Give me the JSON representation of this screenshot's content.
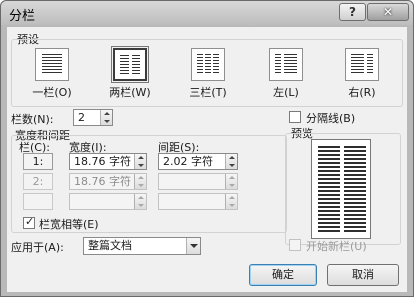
{
  "window": {
    "title": "分栏",
    "help_label": "?",
    "close_label": "✕"
  },
  "presets": {
    "group_label": "预设",
    "items": [
      {
        "label": "一栏(O)",
        "columns": 1,
        "selected": false
      },
      {
        "label": "两栏(W)",
        "columns": 2,
        "selected": true
      },
      {
        "label": "三栏(T)",
        "columns": 3,
        "selected": false
      },
      {
        "label": "左(L)",
        "columns": 2,
        "selected": false
      },
      {
        "label": "右(R)",
        "columns": 2,
        "selected": false
      }
    ]
  },
  "column_count": {
    "label": "栏数(N):",
    "value": "2"
  },
  "divider": {
    "label": "分隔线(B)",
    "checked": false
  },
  "width_spacing": {
    "group_label": "宽度和间距",
    "col_header": "栏(C):",
    "width_header": "宽度(I):",
    "spacing_header": "间距(S):",
    "rows": [
      {
        "num": "1:",
        "width": "18.76 字符",
        "spacing": "2.02 字符",
        "enabled": true
      },
      {
        "num": "2:",
        "width": "18.76 字符",
        "spacing": "",
        "enabled": false
      },
      {
        "num": "",
        "width": "",
        "spacing": "",
        "enabled": false
      }
    ]
  },
  "equal_width": {
    "label": "栏宽相等(E)",
    "checked": true
  },
  "preview": {
    "label": "预览"
  },
  "apply_to": {
    "label": "应用于(A):",
    "value": "整篇文档"
  },
  "new_column": {
    "label": "开始新栏(U)",
    "checked": false,
    "enabled": false
  },
  "buttons": {
    "ok": "确定",
    "cancel": "取消"
  }
}
